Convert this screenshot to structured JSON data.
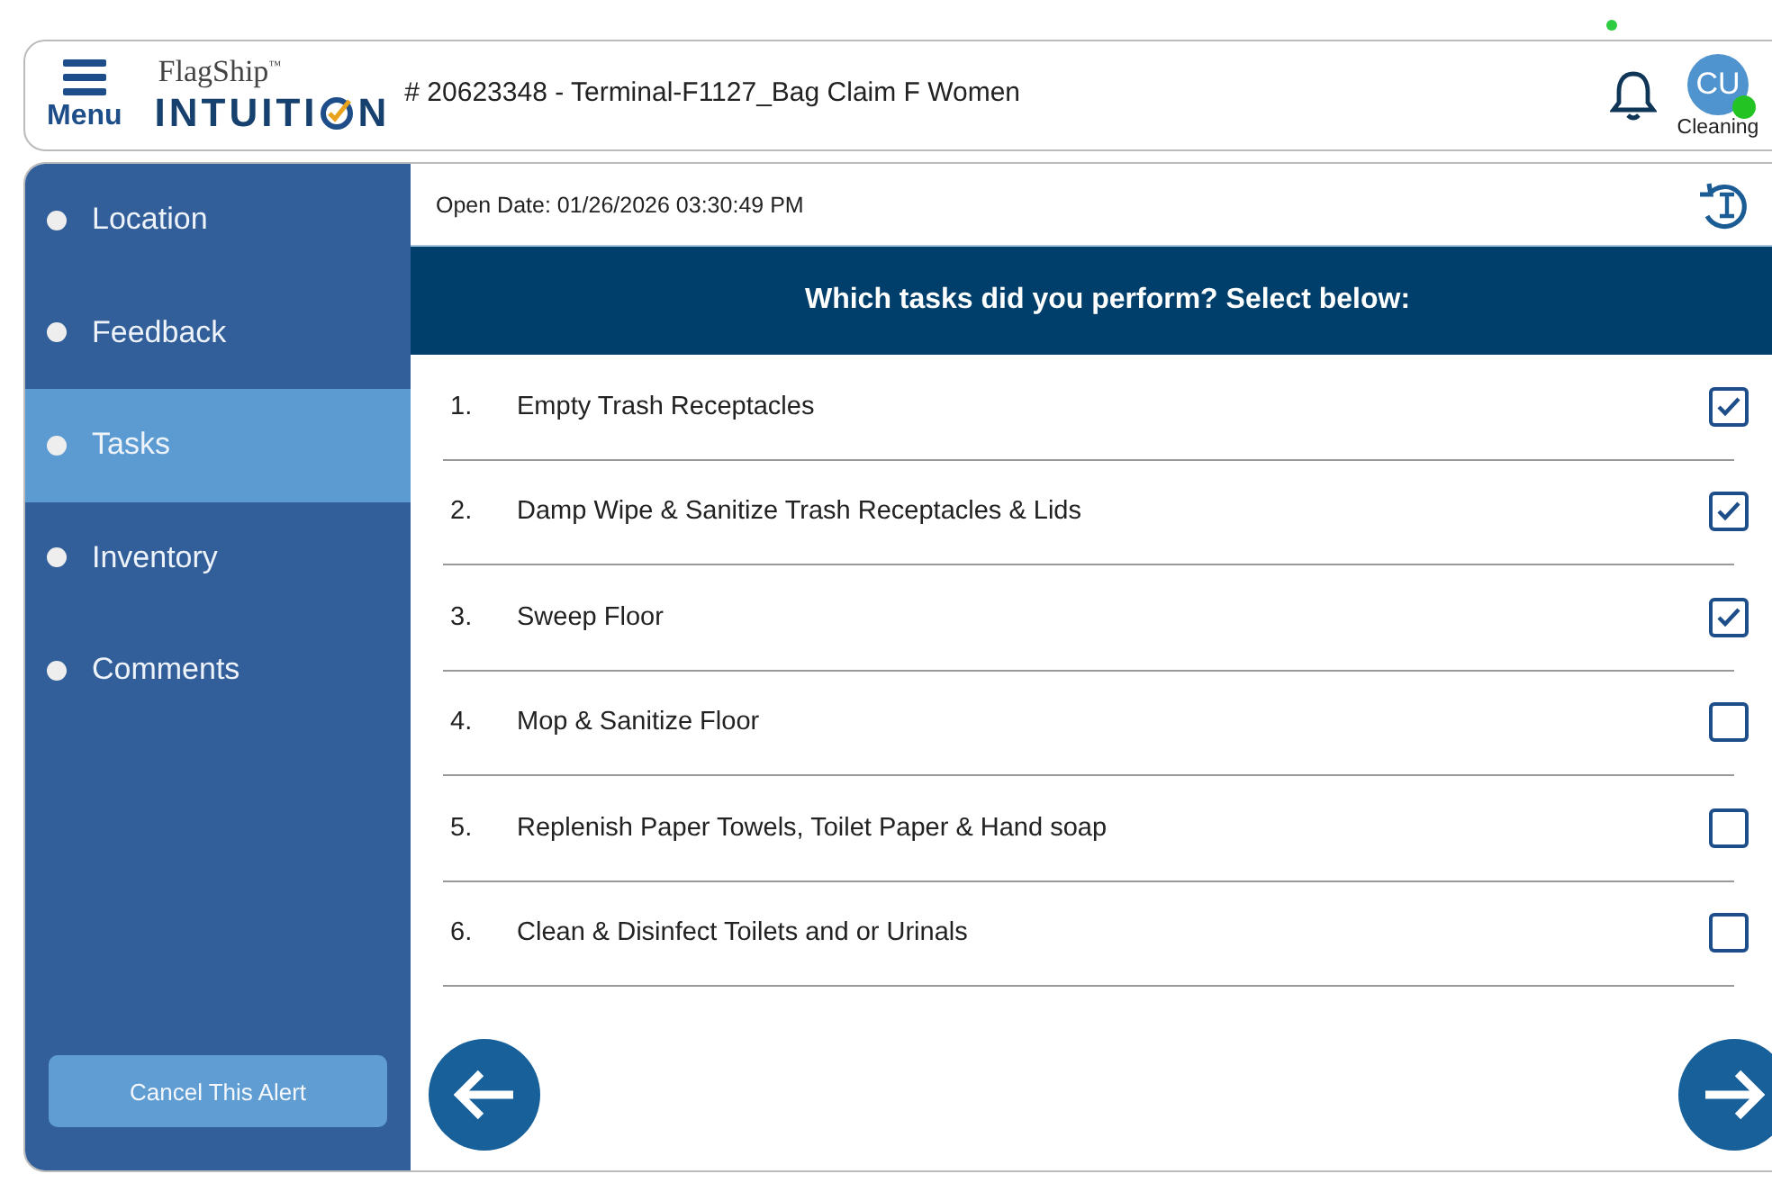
{
  "header": {
    "menu_label": "Menu",
    "brand_top": "FlagShip",
    "brand_tm": "™",
    "brand_main_1": "INTUITI",
    "brand_main_2": "N",
    "title": "# 20623348 - Terminal-F1127_Bag Claim F Women",
    "avatar": {
      "initials": "CU",
      "role": "Cleaning",
      "online": true
    }
  },
  "sidebar": {
    "items": [
      {
        "label": "Location",
        "selected": false
      },
      {
        "label": "Feedback",
        "selected": false
      },
      {
        "label": "Tasks",
        "selected": true
      },
      {
        "label": "Inventory",
        "selected": false
      },
      {
        "label": "Comments",
        "selected": false
      }
    ],
    "cancel_button": "Cancel This Alert"
  },
  "content": {
    "open_date": "Open Date: 01/26/2026 03:30:49 PM",
    "question": "Which tasks did you perform? Select below:",
    "tasks": [
      {
        "number": "1.",
        "label": "Empty Trash Receptacles",
        "checked": true
      },
      {
        "number": "2.",
        "label": "Damp Wipe & Sanitize Trash Receptacles & Lids",
        "checked": true
      },
      {
        "number": "3.",
        "label": "Sweep Floor",
        "checked": true
      },
      {
        "number": "4.",
        "label": "Mop & Sanitize Floor",
        "checked": false
      },
      {
        "number": "5.",
        "label": "Replenish Paper Towels, Toilet Paper & Hand soap",
        "checked": false
      },
      {
        "number": "6.",
        "label": "Clean & Disinfect Toilets and or Urinals",
        "checked": false
      }
    ]
  }
}
